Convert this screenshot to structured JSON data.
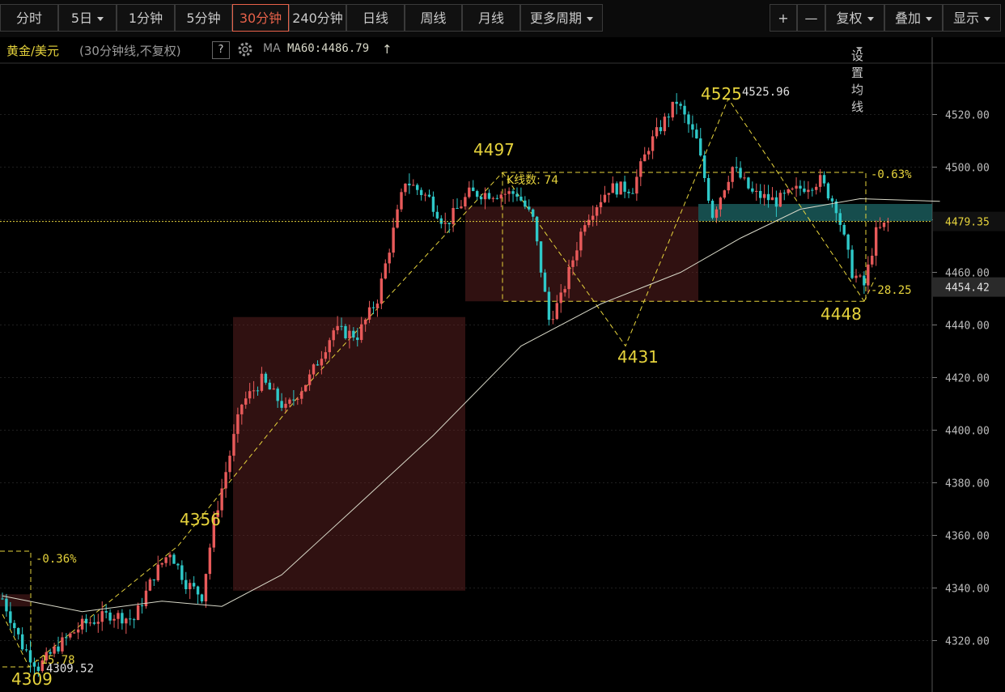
{
  "toolbar": {
    "left_buttons": [
      "分时",
      "5日",
      "1分钟",
      "5分钟",
      "30分钟",
      "240分钟",
      "日线",
      "周线",
      "月线",
      "更多周期"
    ],
    "active_index": 4,
    "zoom_in": "+",
    "zoom_out": "—",
    "right_buttons": [
      "复权",
      "叠加",
      "显示"
    ]
  },
  "infobar": {
    "symbol": "黄金/美元",
    "period_note": "(30分钟线,不复权)",
    "help": "?",
    "ma_label": "MA",
    "ma_value": "MA60:4486.79",
    "ma_arrow": "↑",
    "settings": "设置均线"
  },
  "colors": {
    "up": "#e85a5a",
    "down": "#2ec8c8",
    "ma": "#d8d8c8",
    "annot": "#e6d33c",
    "zone": "#6b2525",
    "zone_teal": "#1f6e6e"
  },
  "chart_data": {
    "type": "candlestick",
    "ylim": [
      4302,
      4538
    ],
    "y_ticks": [
      4320,
      4340,
      4360,
      4380,
      4400,
      4420,
      4440,
      4460,
      4480,
      4500,
      4520
    ],
    "y_tick_labels": [
      "4320.00",
      "4340.00",
      "4360.00",
      "4380.00",
      "4400.00",
      "4420.00",
      "4440.00",
      "4460.00",
      "4480.00",
      "4500.00",
      "4520.00"
    ],
    "current_price": "4479.35",
    "cursor_price": "4454.42",
    "anchors": [
      [
        0,
        4336
      ],
      [
        5,
        4318
      ],
      [
        9,
        4310
      ],
      [
        14,
        4318
      ],
      [
        20,
        4326
      ],
      [
        27,
        4330
      ],
      [
        33,
        4328
      ],
      [
        38,
        4345
      ],
      [
        42,
        4354
      ],
      [
        46,
        4342
      ],
      [
        50,
        4337
      ],
      [
        53,
        4365
      ],
      [
        60,
        4410
      ],
      [
        65,
        4419
      ],
      [
        71,
        4408
      ],
      [
        77,
        4420
      ],
      [
        83,
        4438
      ],
      [
        89,
        4436
      ],
      [
        94,
        4450
      ],
      [
        101,
        4495
      ],
      [
        107,
        4488
      ],
      [
        111,
        4478
      ],
      [
        117,
        4490
      ],
      [
        124,
        4490
      ],
      [
        129,
        4490
      ],
      [
        133,
        4480
      ],
      [
        137,
        4442
      ],
      [
        140,
        4450
      ],
      [
        146,
        4480
      ],
      [
        152,
        4492
      ],
      [
        158,
        4492
      ],
      [
        162,
        4508
      ],
      [
        169,
        4525
      ],
      [
        174,
        4510
      ],
      [
        178,
        4482
      ],
      [
        183,
        4500
      ],
      [
        188,
        4490
      ],
      [
        194,
        4487
      ],
      [
        200,
        4492
      ],
      [
        205,
        4495
      ],
      [
        209,
        4485
      ],
      [
        213,
        4460
      ],
      [
        216,
        4455
      ],
      [
        219,
        4475
      ],
      [
        222,
        4479
      ]
    ],
    "ma_points": [
      [
        0,
        4337
      ],
      [
        20,
        4331
      ],
      [
        40,
        4335
      ],
      [
        55,
        4333
      ],
      [
        70,
        4345
      ],
      [
        88,
        4370
      ],
      [
        108,
        4398
      ],
      [
        130,
        4432
      ],
      [
        150,
        4448
      ],
      [
        170,
        4460
      ],
      [
        185,
        4473
      ],
      [
        200,
        4484
      ],
      [
        215,
        4488
      ],
      [
        235,
        4487
      ]
    ],
    "ma_label": "MA60",
    "levels": {
      "low_4309": "4309",
      "low_4309_precise": "4309.52",
      "high_4356": "4356",
      "high_4497": "4497",
      "low_4431": "4431",
      "high_4525": "4525",
      "high_4525_precise": "4525.96",
      "low_4448": "4448"
    },
    "annotations": {
      "pct_left": "0.36%",
      "pct_right": "0.63%",
      "kline_count": "K线数: 74",
      "diff_left": "15.78",
      "diff_right": "28.25"
    }
  }
}
